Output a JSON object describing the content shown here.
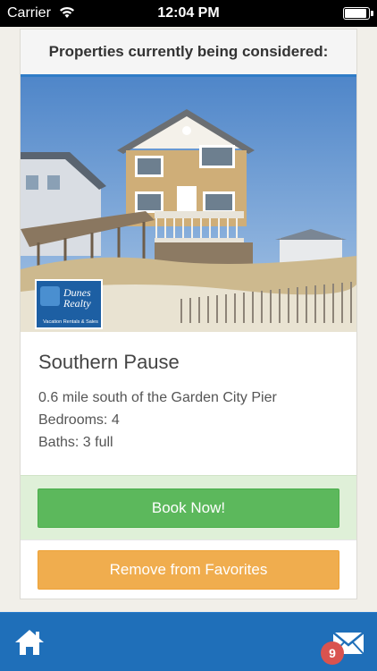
{
  "status_bar": {
    "carrier": "Carrier",
    "time": "12:04 PM"
  },
  "card": {
    "header": "Properties currently being considered:",
    "logo": {
      "line1": "Dunes",
      "line2": "Realty",
      "tagline": "Vacation Rentals & Sales"
    },
    "property": {
      "name": "Southern Pause",
      "location": "0.6 mile south of the Garden City Pier",
      "bedrooms": "Bedrooms: 4",
      "baths": "Baths: 3 full"
    },
    "book_button": "Book Now!",
    "remove_button": "Remove from Favorites"
  },
  "nav": {
    "badge_count": "9"
  },
  "colors": {
    "header_accent": "#2f7cc7",
    "book_green": "#5cb85c",
    "remove_orange": "#f0ad4e",
    "nav_blue": "#1f6fb9",
    "badge_red": "#d9534f"
  },
  "icons": {
    "home": "home-icon",
    "mail": "mail-icon",
    "wifi": "wifi-icon",
    "battery": "battery-icon"
  }
}
